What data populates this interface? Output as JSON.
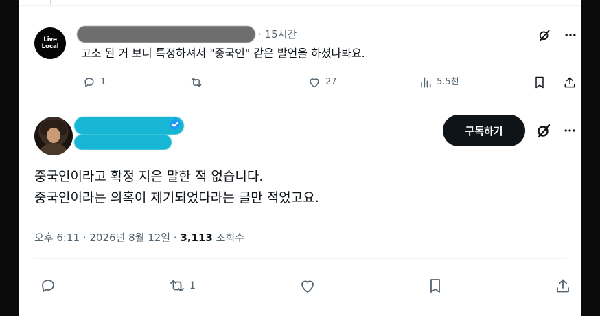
{
  "reply": {
    "avatar_text_line1": "Live",
    "avatar_text_line2": "Local",
    "time": "· 15시간",
    "text": "고소 된 거 보니 특정하셔서 \"중국인\" 같은 발언을 하셨나봐요.",
    "actions": {
      "reply_count": "1",
      "retweet_count": "",
      "like_count": "27",
      "views_count": "5.5천"
    }
  },
  "main": {
    "subscribe_label": "구독하기",
    "text_line1": "중국인이라고 확정 지은 말한 적 없습니다.",
    "text_line2": "중국인이라는 의혹이 제기되었다라는 글만 적었고요.",
    "timestamp": "오후 6:11 · 2026년 8월 12일 · ",
    "views_number": "3,113",
    "views_label": " 조회수",
    "actions": {
      "retweet_count": "1"
    }
  },
  "icons": {
    "grok": "grok-icon",
    "more": "more-icon",
    "reply": "reply-icon",
    "retweet": "retweet-icon",
    "like": "heart-icon",
    "views": "views-icon",
    "bookmark": "bookmark-icon",
    "share": "share-icon",
    "verified": "verified-badge-icon"
  },
  "colors": {
    "text_primary": "#0f1419",
    "text_secondary": "#536471",
    "verified_blue": "#1d9bf0",
    "button_dark": "#0f1419"
  }
}
